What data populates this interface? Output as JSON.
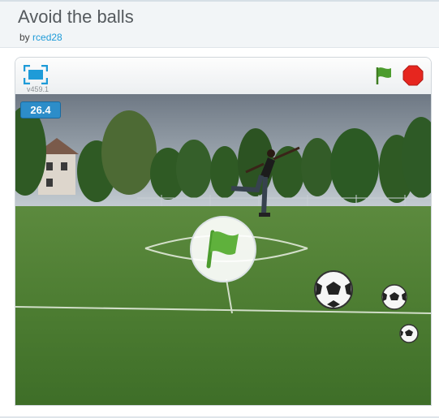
{
  "project": {
    "title": "Avoid the balls",
    "by_prefix": "by",
    "author": "rced28"
  },
  "player": {
    "version": "v459.1",
    "timer_value": "26.4",
    "icons": {
      "fullscreen": "fullscreen-icon",
      "green_flag": "green-flag-icon",
      "stop": "stop-sign-icon",
      "start_overlay": "green-flag-start-icon"
    }
  },
  "colors": {
    "accent_blue": "#1e9bd8",
    "timer_bg": "#2d8dc9",
    "flag_green": "#4c9c2e",
    "stop_red": "#e6261f"
  }
}
